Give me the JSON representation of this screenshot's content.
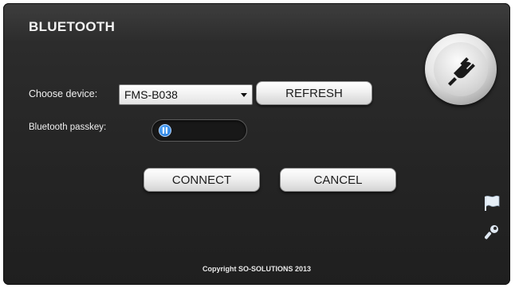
{
  "window": {
    "title": "BLUETOOTH"
  },
  "form": {
    "choose_device_label": "Choose device:",
    "device_selected": "FMS-B038",
    "refresh_label": "REFRESH",
    "passkey_label": "Bluetooth passkey:",
    "passkey_value": ""
  },
  "actions": {
    "connect_label": "CONNECT",
    "cancel_label": "CANCEL"
  },
  "icons": {
    "connect": "plug-icon",
    "flag": "flag-icon",
    "tool": "wrench-icon"
  },
  "footer": {
    "copyright": "Copyright SO-SOLUTIONS 2013"
  }
}
